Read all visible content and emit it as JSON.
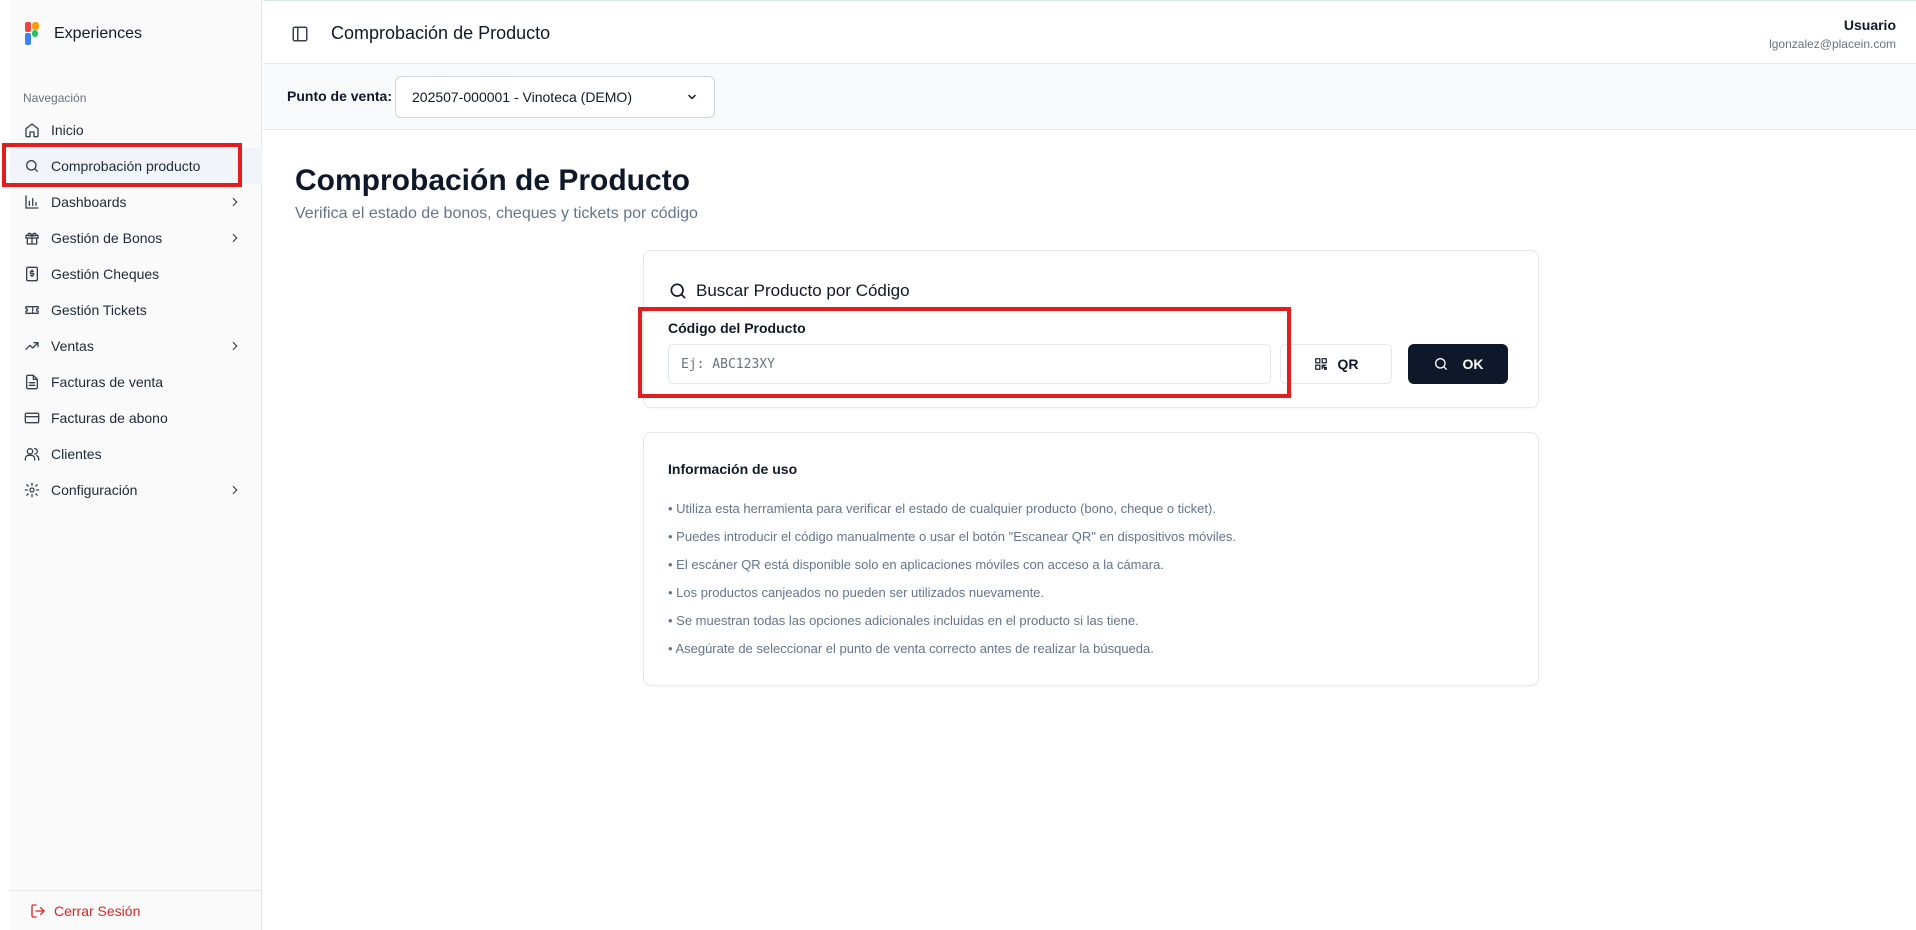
{
  "sidebar": {
    "brand": "Experiences",
    "section_label": "Navegación",
    "items": [
      {
        "label": "Inicio",
        "icon": "home-icon"
      },
      {
        "label": "Comprobación producto",
        "icon": "search-icon"
      },
      {
        "label": "Dashboards",
        "icon": "bar-chart-icon"
      },
      {
        "label": "Gestión de Bonos",
        "icon": "gift-icon"
      },
      {
        "label": "Gestión Cheques",
        "icon": "dollar-receipt-icon"
      },
      {
        "label": "Gestión Tickets",
        "icon": "ticket-icon"
      },
      {
        "label": "Ventas",
        "icon": "trending-up-icon"
      },
      {
        "label": "Facturas de venta",
        "icon": "file-text-icon"
      },
      {
        "label": "Facturas de abono",
        "icon": "credit-card-icon"
      },
      {
        "label": "Clientes",
        "icon": "users-icon"
      },
      {
        "label": "Configuración",
        "icon": "gear-icon"
      }
    ],
    "logout": "Cerrar Sesión"
  },
  "topbar": {
    "title": "Comprobación de Producto",
    "user_name": "Usuario",
    "user_email": "lgonzalez@placein.com"
  },
  "pos": {
    "label": "Punto de venta:",
    "selected": "202507-000001 - Vinoteca (DEMO)"
  },
  "page": {
    "title": "Comprobación de Producto",
    "subtitle": "Verifica el estado de bonos, cheques y tickets por código"
  },
  "search": {
    "title": "Buscar Producto por Código",
    "field_label": "Código del Producto",
    "placeholder": "Ej: ABC123XY",
    "value": "",
    "qr_label": "QR",
    "ok_label": "OK"
  },
  "info": {
    "title": "Información de uso",
    "lines": [
      "• Utiliza esta herramienta para verificar el estado de cualquier producto (bono, cheque o ticket).",
      "• Puedes introducir el código manualmente o usar el botón \"Escanear QR\" en dispositivos móviles.",
      "• El escáner QR está disponible solo en aplicaciones móviles con acceso a la cámara.",
      "• Los productos canjeados no pueden ser utilizados nuevamente.",
      "• Se muestran todas las opciones adicionales incluidas en el producto si las tiene.",
      "• Asegúrate de seleccionar el punto de venta correcto antes de realizar la búsqueda."
    ]
  },
  "colors": {
    "highlight": "#e11d1d",
    "primary_button": "#0f172a",
    "logout": "#dc2626"
  }
}
